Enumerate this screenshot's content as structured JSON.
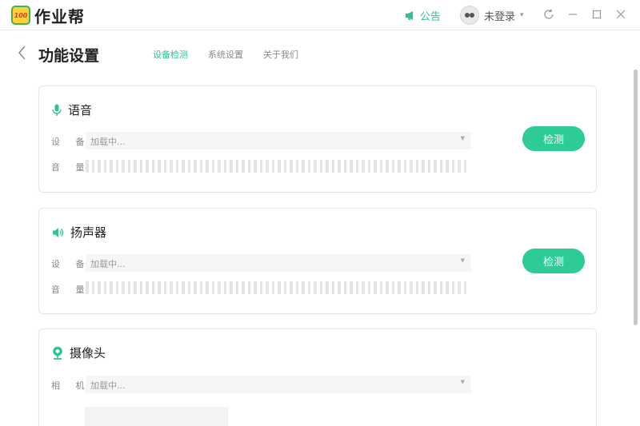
{
  "app": {
    "title": "作业帮",
    "logo_text": "100"
  },
  "titlebar": {
    "notice_label": "公告",
    "user_label": "未登录"
  },
  "header": {
    "title": "功能设置",
    "tabs": [
      {
        "label": "设备检测"
      },
      {
        "label": "系统设置"
      },
      {
        "label": "关于我们"
      }
    ]
  },
  "sections": {
    "mic": {
      "title": "语音",
      "device_label": "设 备",
      "device_value": "加载中...",
      "volume_label": "音 量",
      "detect_label": "检测"
    },
    "speaker": {
      "title": "扬声器",
      "device_label": "设 备",
      "device_value": "加载中...",
      "volume_label": "音 量",
      "detect_label": "检测"
    },
    "camera": {
      "title": "摄像头",
      "device_label": "相 机",
      "device_value": "加载中..."
    }
  },
  "colors": {
    "accent": "#2dc48f",
    "button": "#2dcb95"
  },
  "icons": [
    "megaphone-icon",
    "avatar-icon",
    "refresh-icon",
    "minimize-icon",
    "maximize-icon",
    "close-icon",
    "back-icon",
    "mic-icon",
    "speaker-icon",
    "camera-icon"
  ]
}
